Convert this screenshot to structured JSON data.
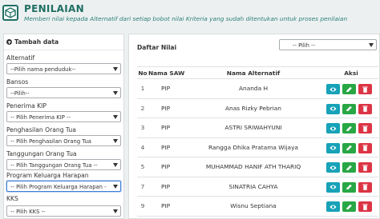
{
  "header": {
    "title": "PENILAIAN",
    "subtitle": "Memberi nilai kepada Alternatif dari setiap bobot nilai Kriteria yang sudah ditentukan untuk proses penilaian",
    "icon": "cube-icon"
  },
  "sidebar": {
    "heading": "Tambah data",
    "filters": [
      {
        "label": "Alternatif",
        "value": "--Pilih nama penduduk--"
      },
      {
        "label": "Bansos",
        "value": "--Pilih--"
      },
      {
        "label": "Penerima KIP",
        "value": "-- Pilih Penerima KIP --"
      },
      {
        "label": "Penghasilan Orang Tua",
        "value": "-- Pilih Penghasilan Orang Tua"
      },
      {
        "label": "Tanggungan Orang Tua",
        "value": "-- Pilih Tanggungan Orang Tua --"
      },
      {
        "label": "Program Keluarga Harapan",
        "value": "-- Pilih Program Keluarga Harapan -"
      },
      {
        "label": "KKS",
        "value": "-- Pilih KKS --"
      }
    ]
  },
  "main": {
    "list_title": "Daftar Nilai",
    "filter_value": "-- Pilih --",
    "columns": [
      "No",
      "Nama SAW",
      "Nama Alternatif",
      "Aksi"
    ],
    "rows": [
      {
        "no": "1",
        "saw": "PIP",
        "alt": "Ananda H"
      },
      {
        "no": "2",
        "saw": "PIP",
        "alt": "Anas Rizky Pebrian"
      },
      {
        "no": "3",
        "saw": "PIP",
        "alt": "ASTRI SRIWAHYUNI"
      },
      {
        "no": "4",
        "saw": "PIP",
        "alt": "Rangga Dhika Pratama Wijaya"
      },
      {
        "no": "5",
        "saw": "PIP",
        "alt": "MUHAMMAD HANIF ATH THARIQ"
      },
      {
        "no": "7",
        "saw": "PIP",
        "alt": "SINATRIA CAHYA"
      },
      {
        "no": "9",
        "saw": "PIP",
        "alt": "Wisnu Septiana"
      }
    ],
    "actions": {
      "view_icon": "eye-icon",
      "edit_icon": "pencil-icon",
      "delete_icon": "trash-icon"
    }
  },
  "colors": {
    "accent": "#1f6f63",
    "view": "#17a2b8",
    "edit": "#28a745",
    "delete": "#dc3545"
  }
}
